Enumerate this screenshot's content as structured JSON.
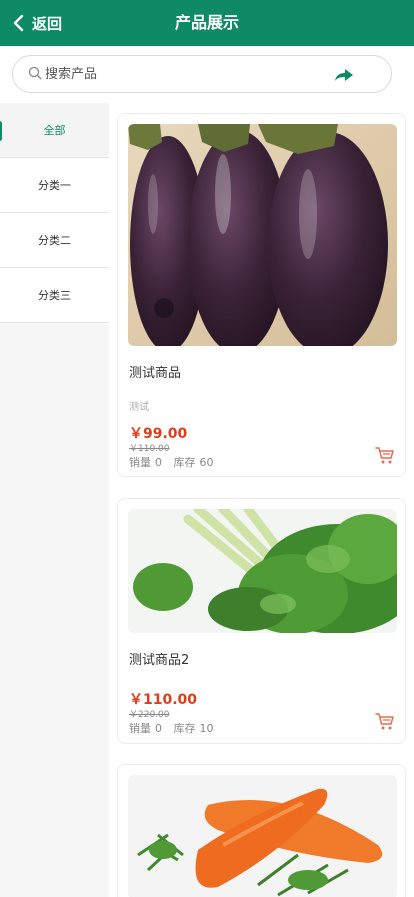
{
  "header": {
    "back_label": "返回",
    "title": "产品展示"
  },
  "search": {
    "placeholder": "搜索产品",
    "value": ""
  },
  "sidebar": {
    "items": [
      {
        "label": "全部",
        "active": true
      },
      {
        "label": "分类一",
        "active": false
      },
      {
        "label": "分类二",
        "active": false
      },
      {
        "label": "分类三",
        "active": false
      }
    ]
  },
  "products": [
    {
      "name": "测试商品",
      "desc": "测试",
      "price": "￥99.00",
      "original_price": "￥110.00",
      "sales_label": "销量",
      "sales": "0",
      "stock_label": "库存",
      "stock": "60",
      "image_icon": "eggplant-image"
    },
    {
      "name": "测试商品2",
      "desc": "",
      "price": "￥110.00",
      "original_price": "￥220.00",
      "sales_label": "销量",
      "sales": "0",
      "stock_label": "库存",
      "stock": "10",
      "image_icon": "celery-image"
    },
    {
      "name": "",
      "desc": "",
      "price": "",
      "original_price": "",
      "image_icon": "carrot-image"
    }
  ],
  "colors": {
    "brand": "#0e8b66",
    "price": "#e33b1a",
    "cart": "#e86a50"
  }
}
